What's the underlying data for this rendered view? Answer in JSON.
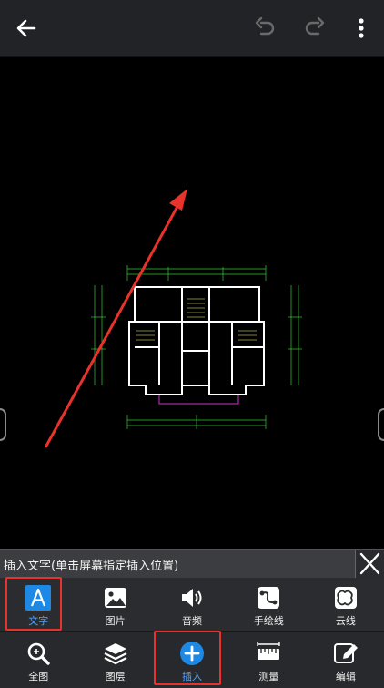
{
  "topbar": {
    "back_icon": "back-arrow-icon",
    "undo_icon": "undo-icon",
    "redo_icon": "redo-icon",
    "more_icon": "more-vert-icon"
  },
  "hint": {
    "text": "插入文字(单击屏幕指定插入位置)",
    "close_icon": "close-icon"
  },
  "insert_tools": [
    {
      "label": "文字",
      "icon": "text-A-icon",
      "active": true
    },
    {
      "label": "图片",
      "icon": "image-icon"
    },
    {
      "label": "音频",
      "icon": "speaker-icon"
    },
    {
      "label": "手绘线",
      "icon": "freehand-icon"
    },
    {
      "label": "云线",
      "icon": "cloud-line-icon"
    }
  ],
  "main_tools": [
    {
      "label": "全图",
      "icon": "fit-view-icon"
    },
    {
      "label": "图层",
      "icon": "layers-icon"
    },
    {
      "label": "插入",
      "icon": "plus-circle-icon",
      "active": true
    },
    {
      "label": "测量",
      "icon": "ruler-icon"
    },
    {
      "label": "编辑",
      "icon": "pencil-icon"
    }
  ],
  "colors": {
    "accent": "#1e88e5",
    "highlight_box": "#e8322b",
    "arrow": "#e8322b",
    "drawing_lines": "#ffffff",
    "dimension_lines": "#33cc33",
    "dimension_text": "#ffff66"
  }
}
